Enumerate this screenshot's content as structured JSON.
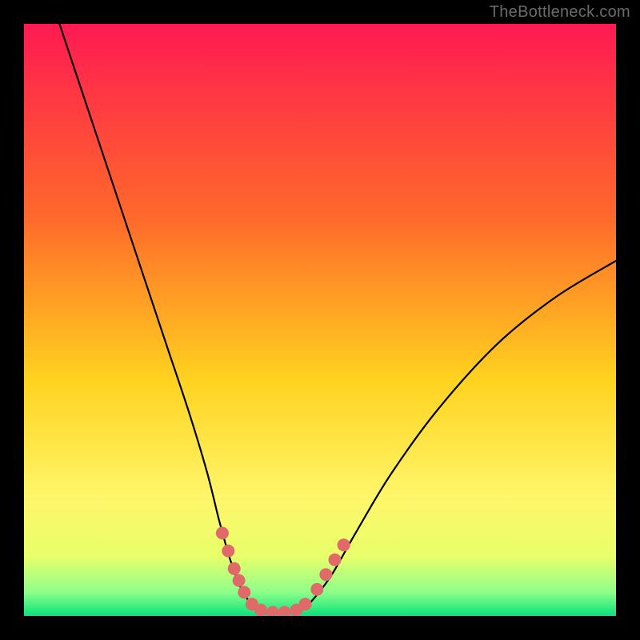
{
  "watermark": "TheBottleneck.com",
  "chart_data": {
    "type": "line",
    "title": "",
    "xlabel": "",
    "ylabel": "",
    "xlim": [
      0,
      100
    ],
    "ylim": [
      0,
      100
    ],
    "background_gradient": {
      "stops": [
        {
          "offset": 0.0,
          "color": "#ff1a52"
        },
        {
          "offset": 0.33,
          "color": "#ff6a2a"
        },
        {
          "offset": 0.6,
          "color": "#ffd21f"
        },
        {
          "offset": 0.8,
          "color": "#fff66a"
        },
        {
          "offset": 0.9,
          "color": "#e8ff6a"
        },
        {
          "offset": 0.96,
          "color": "#8dff8a"
        },
        {
          "offset": 1.0,
          "color": "#08e27a"
        }
      ]
    },
    "series": [
      {
        "name": "bottleneck-curve",
        "stroke": "#000000",
        "stroke_width": 2.2,
        "points": [
          {
            "x": 6,
            "y": 100
          },
          {
            "x": 9,
            "y": 91
          },
          {
            "x": 12,
            "y": 82
          },
          {
            "x": 16,
            "y": 70
          },
          {
            "x": 20,
            "y": 58
          },
          {
            "x": 24,
            "y": 46
          },
          {
            "x": 28,
            "y": 34
          },
          {
            "x": 31,
            "y": 24
          },
          {
            "x": 33,
            "y": 16
          },
          {
            "x": 35,
            "y": 9
          },
          {
            "x": 37,
            "y": 4
          },
          {
            "x": 39,
            "y": 1.5
          },
          {
            "x": 41,
            "y": 0.5
          },
          {
            "x": 44,
            "y": 0.5
          },
          {
            "x": 47,
            "y": 1.2
          },
          {
            "x": 49,
            "y": 3
          },
          {
            "x": 52,
            "y": 7
          },
          {
            "x": 56,
            "y": 14
          },
          {
            "x": 62,
            "y": 24
          },
          {
            "x": 70,
            "y": 35
          },
          {
            "x": 80,
            "y": 46
          },
          {
            "x": 90,
            "y": 54
          },
          {
            "x": 100,
            "y": 60
          }
        ]
      }
    ],
    "markers": {
      "name": "highlight-dots",
      "color": "#e06a6a",
      "radius": 8,
      "points": [
        {
          "x": 33.5,
          "y": 14
        },
        {
          "x": 34.5,
          "y": 11
        },
        {
          "x": 35.5,
          "y": 8
        },
        {
          "x": 36.3,
          "y": 6
        },
        {
          "x": 37.2,
          "y": 4
        },
        {
          "x": 38.5,
          "y": 2
        },
        {
          "x": 40.0,
          "y": 1
        },
        {
          "x": 42.0,
          "y": 0.6
        },
        {
          "x": 44.0,
          "y": 0.6
        },
        {
          "x": 46.0,
          "y": 1
        },
        {
          "x": 47.5,
          "y": 2
        },
        {
          "x": 49.5,
          "y": 4.5
        },
        {
          "x": 51.0,
          "y": 7
        },
        {
          "x": 52.5,
          "y": 9.5
        },
        {
          "x": 54.0,
          "y": 12
        }
      ]
    }
  }
}
